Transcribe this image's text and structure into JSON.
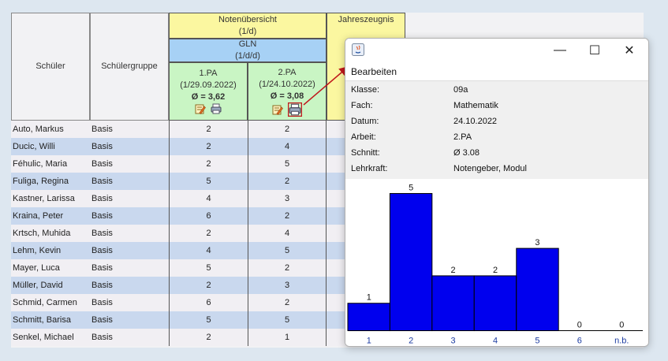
{
  "header": {
    "col_student": "Schüler",
    "col_group": "Schülergruppe",
    "notenuebersicht": "Notenübersicht",
    "notenuebersicht_sub": "(1/d)",
    "jahreszeugnis": "Jahreszeugnis",
    "gln": "GLN",
    "gln_sub": "(1/d/d)",
    "pa1_title": "1.PA",
    "pa1_date": "(1/29.09.2022)",
    "pa1_avg": "Ø = 3,62",
    "pa2_title": "2.PA",
    "pa2_date": "(1/24.10.2022)",
    "pa2_avg": "Ø = 3,08"
  },
  "students": [
    {
      "name": "Auto, Markus",
      "group": "Basis",
      "pa1": "2",
      "pa2": "2"
    },
    {
      "name": "Ducic, Willi",
      "group": "Basis",
      "pa1": "2",
      "pa2": "4"
    },
    {
      "name": "Féhulic, Maria",
      "group": "Basis",
      "pa1": "2",
      "pa2": "5"
    },
    {
      "name": "Fuliga, Regina",
      "group": "Basis",
      "pa1": "5",
      "pa2": "2"
    },
    {
      "name": "Kastner, Larissa",
      "group": "Basis",
      "pa1": "4",
      "pa2": "3"
    },
    {
      "name": "Kraina, Peter",
      "group": "Basis",
      "pa1": "6",
      "pa2": "2"
    },
    {
      "name": "Krtsch, Muhida",
      "group": "Basis",
      "pa1": "2",
      "pa2": "4"
    },
    {
      "name": "Lehm, Kevin",
      "group": "Basis",
      "pa1": "4",
      "pa2": "5"
    },
    {
      "name": "Mayer, Luca",
      "group": "Basis",
      "pa1": "5",
      "pa2": "2"
    },
    {
      "name": "Müller, David",
      "group": "Basis",
      "pa1": "2",
      "pa2": "3"
    },
    {
      "name": "Schmid, Carmen",
      "group": "Basis",
      "pa1": "6",
      "pa2": "2"
    },
    {
      "name": "Schmitt, Barisa",
      "group": "Basis",
      "pa1": "5",
      "pa2": "5"
    },
    {
      "name": "Senkel, Michael",
      "group": "Basis",
      "pa1": "2",
      "pa2": "1"
    }
  ],
  "dialog": {
    "minimize": "—",
    "maximize": "☐",
    "close": "✕",
    "menu_edit": "Bearbeiten",
    "info": [
      {
        "label": "Klasse:",
        "value": "09a"
      },
      {
        "label": "Fach:",
        "value": "Mathematik"
      },
      {
        "label": "Datum:",
        "value": "24.10.2022"
      },
      {
        "label": "Arbeit:",
        "value": "2.PA"
      },
      {
        "label": "Schnitt:",
        "value": "Ø 3.08"
      },
      {
        "label": "Lehrkraft:",
        "value": "Notengeber, Modul"
      }
    ]
  },
  "colors": {
    "header_yellow": "#fbf7a0",
    "header_blue": "#a7d1f5",
    "header_green": "#c9f5c4",
    "row_even": "#c9d8ee",
    "row_odd": "#f1eff3",
    "bar": "#0000ee",
    "arrow": "#c0181c"
  },
  "chart_data": {
    "type": "bar",
    "categories": [
      "1",
      "2",
      "3",
      "4",
      "5",
      "6",
      "n.b."
    ],
    "values": [
      1,
      5,
      2,
      2,
      3,
      0,
      0
    ],
    "ylim": [
      0,
      5
    ],
    "grid": false,
    "legend": "none"
  }
}
